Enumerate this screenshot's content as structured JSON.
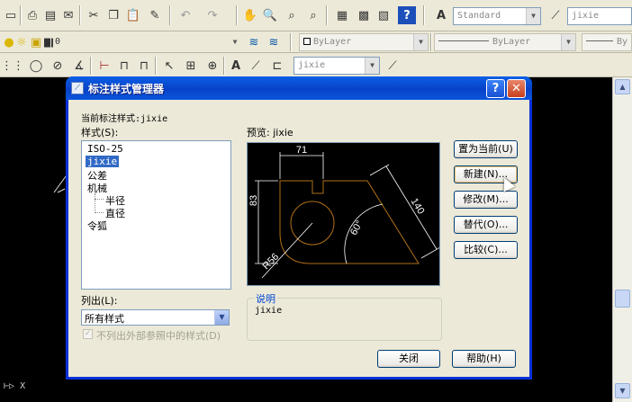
{
  "toolbar": {
    "text_style": "Standard",
    "dim_style": "jixie",
    "layer_value": "0",
    "color_value": "ByLayer",
    "linetype_value": "ByLayer",
    "lineweight_partial": "By",
    "dim_style_small": "jixie"
  },
  "dialog": {
    "title": "标注样式管理器",
    "help_glyph": "?",
    "close_glyph": "✕",
    "current_style_label": "当前标注样式:jixie",
    "styles_label": "样式(S):",
    "styles": {
      "s0": "ISO-25",
      "s1": "jixie",
      "s2": "公差",
      "s3": "机械",
      "s4": "半径",
      "s5": "直径",
      "s6": "令狐"
    },
    "preview_label": "预览: jixie",
    "preview_dims": {
      "d71": "71",
      "d83": "83",
      "d140": "140",
      "d60": "60°",
      "r56": "R56"
    },
    "list_label": "列出(L):",
    "list_value": "所有样式",
    "xref_checkbox": "不列出外部参照中的样式(D)",
    "desc_caption": "说明",
    "desc_text": "jixie",
    "buttons": {
      "set_current": "置为当前(U)",
      "new": "新建(N)...",
      "modify": "修改(M)...",
      "override": "替代(O)...",
      "compare": "比较(C)...",
      "close": "关闭",
      "help": "帮助(H)"
    }
  },
  "ucs_label": "X"
}
